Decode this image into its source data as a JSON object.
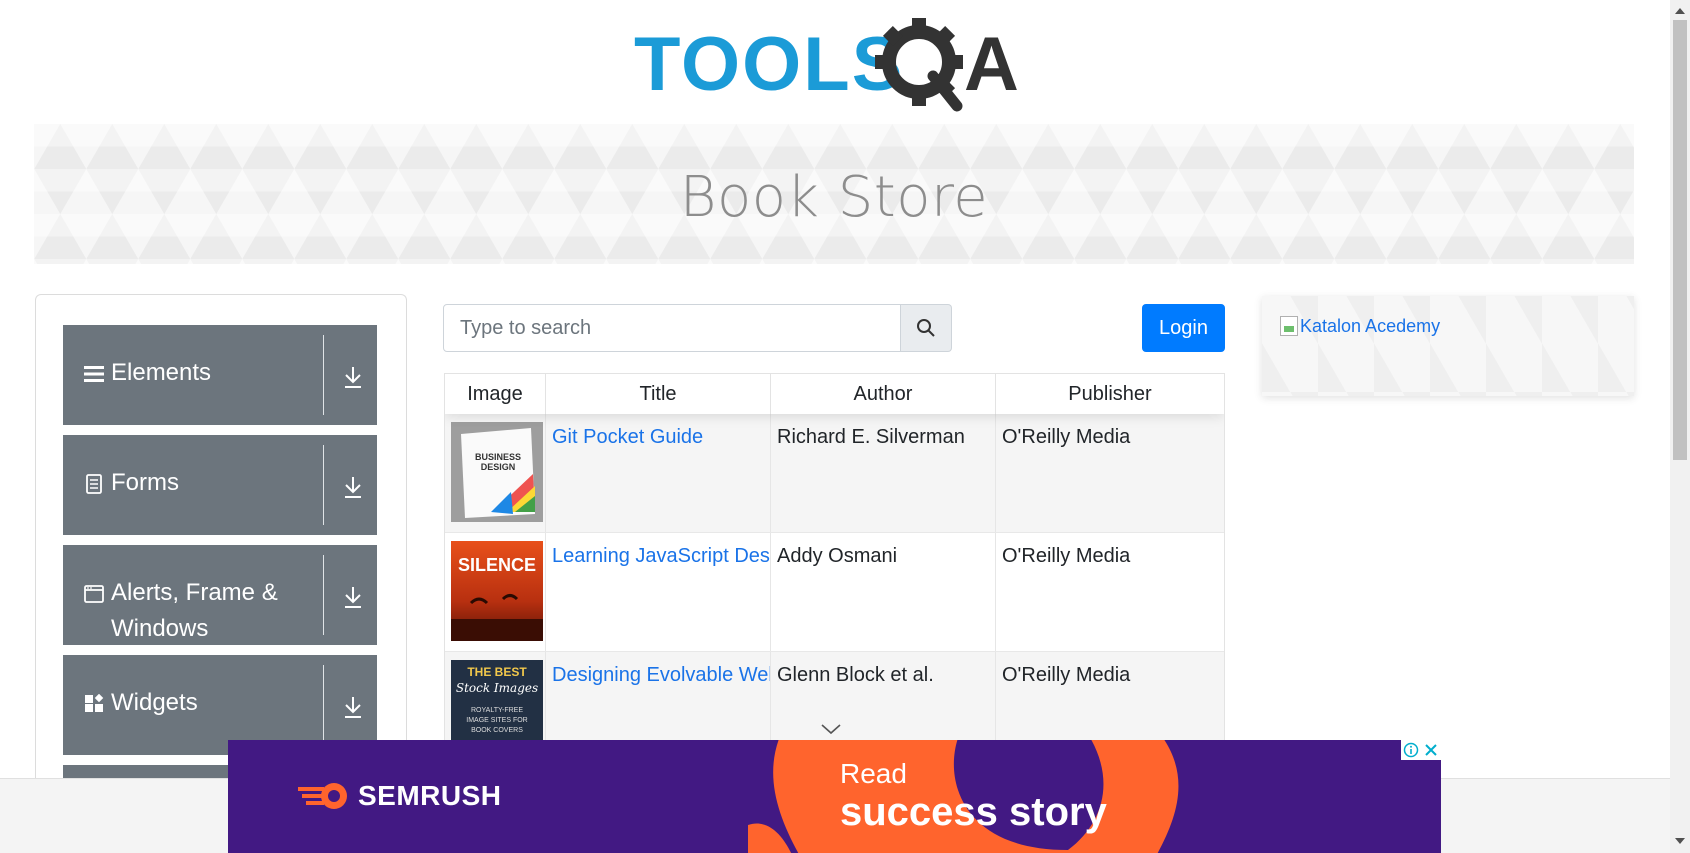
{
  "header": {
    "logo_alt": "TOOLSQA",
    "logo_text_left": "TOOLS",
    "logo_text_right": "A",
    "brand_color": "#1b9bd7",
    "dark_color": "#333333"
  },
  "banner": {
    "title": "Book Store"
  },
  "sidebar": {
    "groups": [
      {
        "label": "Elements",
        "icon": "hamburger-icon"
      },
      {
        "label": "Forms",
        "icon": "document-icon"
      },
      {
        "label": "Alerts, Frame & Windows",
        "icon": "window-icon"
      },
      {
        "label": "Widgets",
        "icon": "widgets-icon"
      }
    ]
  },
  "search": {
    "placeholder": "Type to search",
    "value": ""
  },
  "login": {
    "label": "Login",
    "color": "#007bff"
  },
  "table": {
    "headers": [
      "Image",
      "Title",
      "Author",
      "Publisher"
    ],
    "rows": [
      {
        "cover": "business-design-cover",
        "title": "Git Pocket Guide",
        "author": "Richard E. Silverman",
        "publisher": "O'Reilly Media"
      },
      {
        "cover": "silence-cover",
        "title": "Learning JavaScript Design Patterns",
        "author": "Addy Osmani",
        "publisher": "O'Reilly Media"
      },
      {
        "cover": "best-stock-images-cover",
        "title": "Designing Evolvable Web APIs with ASP.NET",
        "author": "Glenn Block et al.",
        "publisher": "O'Reilly Media"
      }
    ]
  },
  "side_ad": {
    "alt_text": "Katalon Acedemy"
  },
  "ad": {
    "brand": "SEMRUSH",
    "line1": "Read",
    "line2": "success story",
    "bg_color": "#421983",
    "accent_color": "#ff642d"
  }
}
